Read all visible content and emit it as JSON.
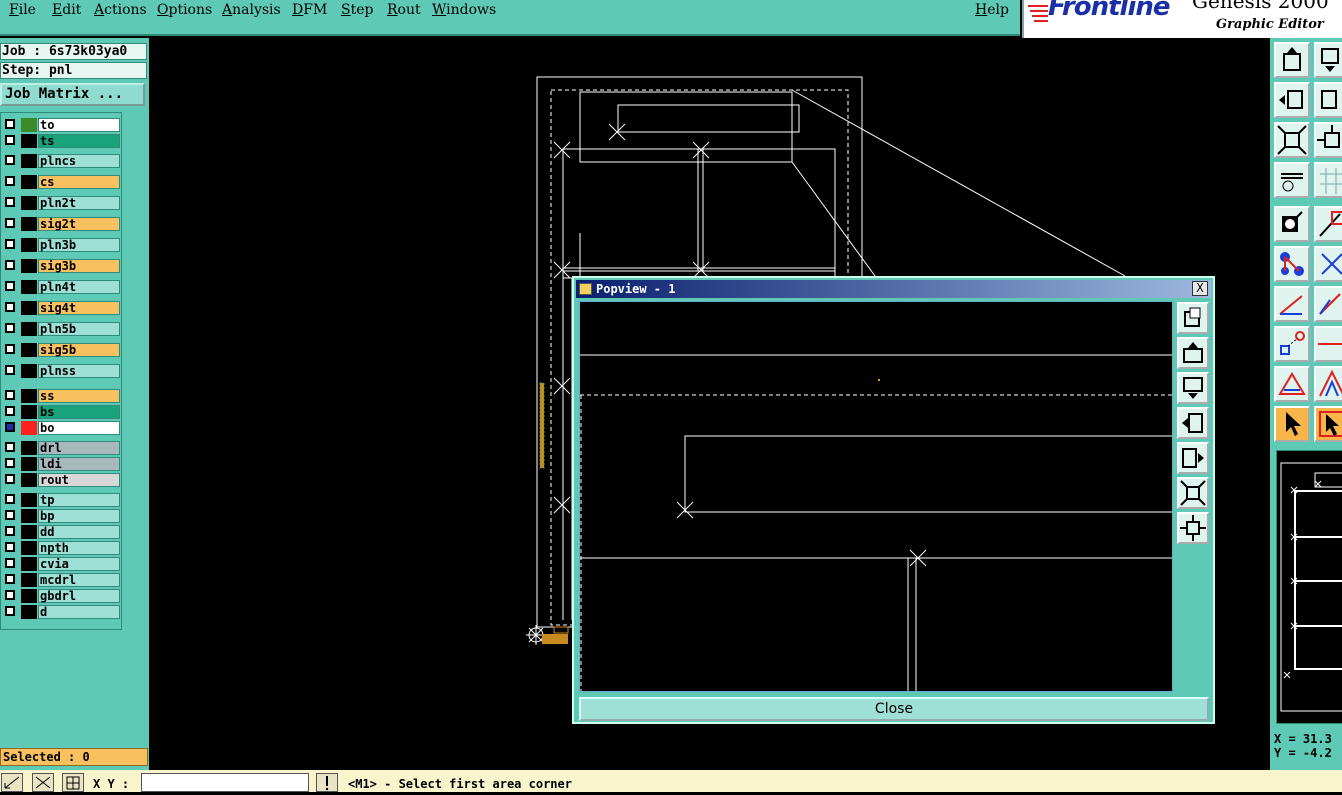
{
  "menu": {
    "items": [
      "File",
      "Edit",
      "Actions",
      "Options",
      "Analysis",
      "DFM",
      "Step",
      "Rout",
      "Windows"
    ],
    "help": "Help"
  },
  "logo": {
    "brand": "Frontline",
    "product": "Genesis 2000",
    "subtitle": "Graphic Editor"
  },
  "job": {
    "job_text": "Job : 6s73k03ya0",
    "step_text": "Step: pnl",
    "matrix_button": "Job Matrix ..."
  },
  "layers": [
    {
      "name": "to",
      "color": "#ffffff",
      "swatch": "#3a8a2a"
    },
    {
      "name": "ts",
      "color": "#1aa37a",
      "swatch": "#000000"
    },
    {
      "name": "plncs",
      "color": "#9fe0d6",
      "swatch": "#000000"
    },
    {
      "name": "cs",
      "color": "#f8c05e",
      "swatch": "#000000"
    },
    {
      "name": "pln2t",
      "color": "#9fe0d6",
      "swatch": "#000000"
    },
    {
      "name": "sig2t",
      "color": "#f8c05e",
      "swatch": "#000000"
    },
    {
      "name": "pln3b",
      "color": "#9fe0d6",
      "swatch": "#000000"
    },
    {
      "name": "sig3b",
      "color": "#f8c05e",
      "swatch": "#000000"
    },
    {
      "name": "pln4t",
      "color": "#9fe0d6",
      "swatch": "#000000"
    },
    {
      "name": "sig4t",
      "color": "#f8c05e",
      "swatch": "#000000"
    },
    {
      "name": "pln5b",
      "color": "#9fe0d6",
      "swatch": "#000000"
    },
    {
      "name": "sig5b",
      "color": "#f8c05e",
      "swatch": "#000000"
    },
    {
      "name": "plnss",
      "color": "#9fe0d6",
      "swatch": "#000000"
    },
    {
      "name": "ss",
      "color": "#f8c05e",
      "swatch": "#000000"
    },
    {
      "name": "bs",
      "color": "#1aa37a",
      "swatch": "#000000"
    },
    {
      "name": "bo",
      "color": "#ffffff",
      "swatch": "#ff2020"
    },
    {
      "name": "drl",
      "color": "#a9b8bd",
      "swatch": "#000000"
    },
    {
      "name": "ldi",
      "color": "#a9b8bd",
      "swatch": "#000000"
    },
    {
      "name": "rout",
      "color": "#d8d8d8",
      "swatch": "#000000"
    },
    {
      "name": "tp",
      "color": "#9fe0d6",
      "swatch": "#000000"
    },
    {
      "name": "bp",
      "color": "#9fe0d6",
      "swatch": "#000000"
    },
    {
      "name": "dd",
      "color": "#9fe0d6",
      "swatch": "#000000"
    },
    {
      "name": "npth",
      "color": "#9fe0d6",
      "swatch": "#000000"
    },
    {
      "name": "cvia",
      "color": "#9fe0d6",
      "swatch": "#000000"
    },
    {
      "name": "mcdrl",
      "color": "#9fe0d6",
      "swatch": "#000000"
    },
    {
      "name": "gbdrl",
      "color": "#9fe0d6",
      "swatch": "#000000"
    },
    {
      "name": "d",
      "color": "#9fe0d6",
      "swatch": "#000000"
    }
  ],
  "selected_text": "Selected : 0",
  "status": {
    "xy_label": "X Y :",
    "xy_value": "",
    "prompt": "<M1> - Select first area corner"
  },
  "popview": {
    "title": "Popview - 1",
    "close_x": "X",
    "close_button": "Close"
  },
  "coords": {
    "x": "X = 31.3",
    "y": "Y = -4.2"
  }
}
